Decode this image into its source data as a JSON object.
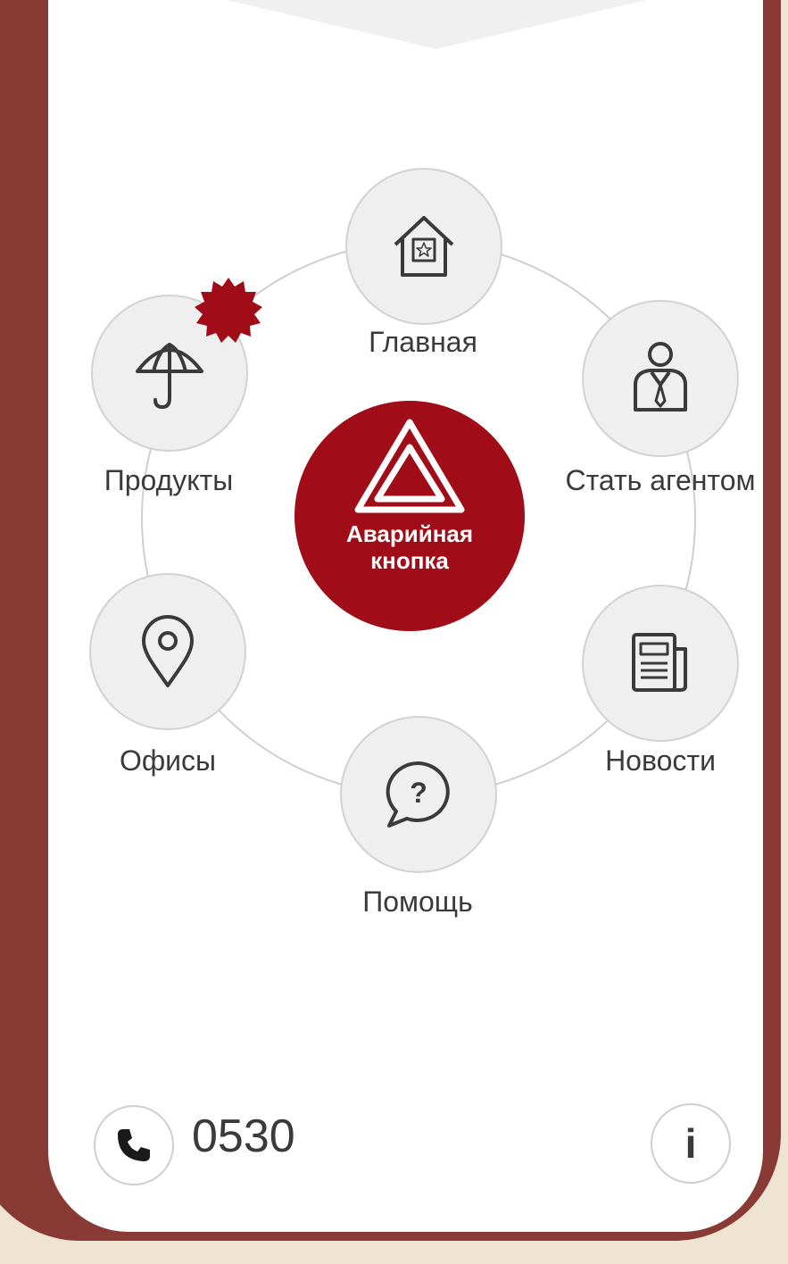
{
  "menu": {
    "home": {
      "label": "Главная",
      "icon": "home-star-icon"
    },
    "agent": {
      "label": "Стать агентом",
      "icon": "agent-tie-icon"
    },
    "news": {
      "label": "Новости",
      "icon": "newspaper-icon"
    },
    "help": {
      "label": "Помощь",
      "icon": "question-bubble-icon"
    },
    "offices": {
      "label": "Офисы",
      "icon": "location-pin-icon"
    },
    "products": {
      "label": "Продукты",
      "icon": "umbrella-icon",
      "badge_color": "#a00c18"
    }
  },
  "emergency": {
    "label": "Аварийная\nкнопка",
    "icon": "warning-triangle-icon",
    "color": "#a00c18"
  },
  "footer": {
    "phone": "0530",
    "call_icon": "phone-icon",
    "info": "i"
  },
  "colors": {
    "frame": "#8a3a35",
    "background": "#efe3d2",
    "accent": "#a00c18"
  }
}
